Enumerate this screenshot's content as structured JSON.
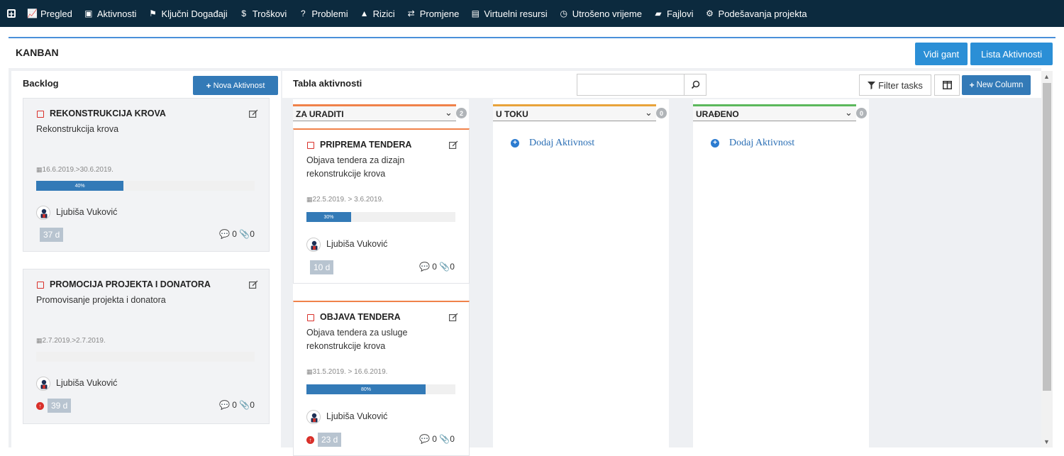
{
  "nav": {
    "items": [
      {
        "icon": "chart-line-icon",
        "glyph": "📈",
        "label": "Pregled"
      },
      {
        "icon": "briefcase-icon",
        "glyph": "▣",
        "label": "Aktivnosti"
      },
      {
        "icon": "flag-icon",
        "glyph": "⚑",
        "label": "Ključni Događaji"
      },
      {
        "icon": "dollar-icon",
        "glyph": "$",
        "label": "Troškovi"
      },
      {
        "icon": "question-icon",
        "glyph": "?",
        "label": "Problemi"
      },
      {
        "icon": "warning-icon",
        "glyph": "▲",
        "label": "Rizici"
      },
      {
        "icon": "exchange-icon",
        "glyph": "⇄",
        "label": "Promjene"
      },
      {
        "icon": "suitcase-icon",
        "glyph": "▤",
        "label": "Virtuelni resursi"
      },
      {
        "icon": "clock-icon",
        "glyph": "◷",
        "label": "Utrošeno vrijeme"
      },
      {
        "icon": "folder-icon",
        "glyph": "▰",
        "label": "Fajlovi"
      },
      {
        "icon": "cogs-icon",
        "glyph": "⚙",
        "label": "Podešavanja projekta"
      }
    ]
  },
  "header": {
    "title": "KANBAN",
    "gant_button": "Vidi gant",
    "list_button": "Lista Aktivnosti"
  },
  "backlog": {
    "title": "Backlog",
    "new_button": "Nova Aktivnost",
    "cards": [
      {
        "title": "REKONSTRUKCIJA KROVA",
        "desc": "Rekonstrukcija krova",
        "dates": "16.6.2019.>30.6.2019.",
        "progress": 40,
        "progress_label": "40%",
        "user": "Ljubiša Vuković",
        "days": "37 d",
        "comments": "0",
        "attachments": "0",
        "warning": false
      },
      {
        "title": "PROMOCIJA PROJEKTA I DONATORA",
        "desc": "Promovisanje projekta i donatora",
        "dates": "2.7.2019.>2.7.2019.",
        "progress": 0,
        "progress_label": "0%",
        "user": "Ljubiša Vuković",
        "days": "39 d",
        "comments": "0",
        "attachments": "0",
        "warning": true
      }
    ]
  },
  "board": {
    "title": "Tabla aktivnosti",
    "search_placeholder": "",
    "filter_button": "Filter tasks",
    "new_column_button": "New Column",
    "columns": [
      {
        "name": "ZA URADITI",
        "count": "2",
        "color": "#f0824a"
      },
      {
        "name": "U TOKU",
        "count": "0",
        "color": "#e8a33a"
      },
      {
        "name": "URAĐENO",
        "count": "0",
        "color": "#5cb85c"
      }
    ],
    "add_activity": "Dodaj Aktivnost",
    "cards": [
      {
        "title": "PRIPREMA TENDERA",
        "desc": "Objava tendera za dizajn rekonstrukcije krova",
        "dates": "22.5.2019. > 3.6.2019.",
        "progress": 30,
        "progress_label": "30%",
        "user": "Ljubiša Vuković",
        "days": "10 d",
        "comments": "0",
        "attachments": "0",
        "warning": false
      },
      {
        "title": "OBJAVA TENDERA",
        "desc": "Objava tendera za usluge rekonstrukcije krova",
        "dates": "31.5.2019. > 16.6.2019.",
        "progress": 80,
        "progress_label": "80%",
        "user": "Ljubiša Vuković",
        "days": "23 d",
        "comments": "0",
        "attachments": "0",
        "warning": true
      }
    ]
  },
  "colors": {
    "nav_bg": "#0c2a3e",
    "primary": "#337ab7",
    "header_btn": "#2b8fd6",
    "warning": "#d9302a"
  }
}
